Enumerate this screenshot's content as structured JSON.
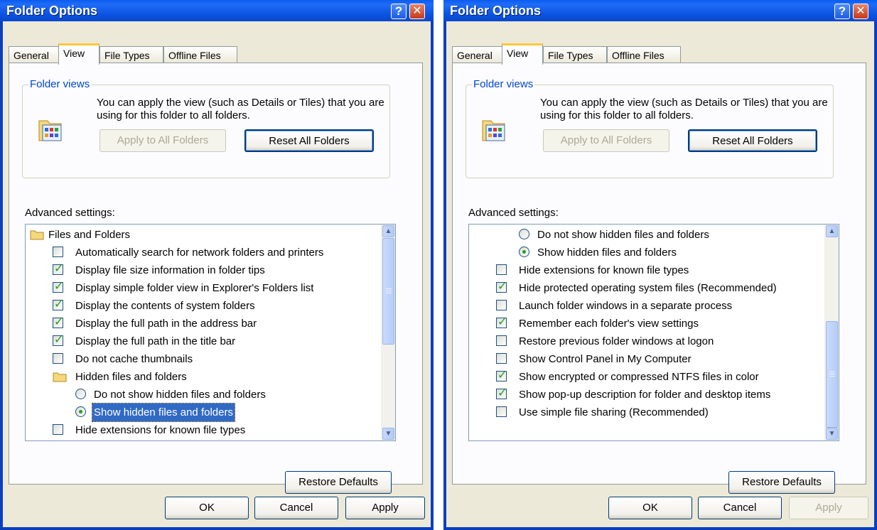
{
  "windows": [
    {
      "title": "Folder Options",
      "help_glyph": "?",
      "close_glyph": "✕",
      "tabs": [
        "General",
        "View",
        "File Types",
        "Offline Files"
      ],
      "active_tab": "View",
      "folder_views": {
        "title": "Folder views",
        "description": "You can apply the view (such as Details or Tiles) that you are using for this folder to all folders.",
        "apply_button": "Apply to All Folders",
        "apply_enabled": false,
        "reset_button": "Reset All Folders"
      },
      "advanced_label": "Advanced settings:",
      "items": [
        {
          "kind": "folder",
          "label": "Files and Folders"
        },
        {
          "kind": "checkbox",
          "checked": false,
          "label": "Automatically search for network folders and printers"
        },
        {
          "kind": "checkbox",
          "checked": true,
          "label": "Display file size information in folder tips"
        },
        {
          "kind": "checkbox",
          "checked": true,
          "label": "Display simple folder view in Explorer's Folders list"
        },
        {
          "kind": "checkbox",
          "checked": true,
          "label": "Display the contents of system folders"
        },
        {
          "kind": "checkbox",
          "checked": true,
          "label": "Display the full path in the address bar"
        },
        {
          "kind": "checkbox",
          "checked": true,
          "label": "Display the full path in the title bar"
        },
        {
          "kind": "checkbox",
          "checked": false,
          "label": "Do not cache thumbnails"
        },
        {
          "kind": "folder",
          "label": "Hidden files and folders"
        },
        {
          "kind": "radio",
          "checked": false,
          "label": "Do not show hidden files and folders"
        },
        {
          "kind": "radio",
          "checked": true,
          "selected": true,
          "label": "Show hidden files and folders"
        },
        {
          "kind": "checkbox",
          "checked": false,
          "label": "Hide extensions for known file types"
        }
      ],
      "scroll_position": "top",
      "restore_button": "Restore Defaults",
      "ok_button": "OK",
      "cancel_button": "Cancel",
      "apply_button": "Apply",
      "apply_enabled": true
    },
    {
      "title": "Folder Options",
      "help_glyph": "?",
      "close_glyph": "✕",
      "tabs": [
        "General",
        "View",
        "File Types",
        "Offline Files"
      ],
      "active_tab": "View",
      "folder_views": {
        "title": "Folder views",
        "description": "You can apply the view (such as Details or Tiles) that you are using for this folder to all folders.",
        "apply_button": "Apply to All Folders",
        "apply_enabled": false,
        "reset_button": "Reset All Folders"
      },
      "advanced_label": "Advanced settings:",
      "items": [
        {
          "kind": "radio",
          "checked": false,
          "label": "Do not show hidden files and folders"
        },
        {
          "kind": "radio",
          "checked": true,
          "label": "Show hidden files and folders"
        },
        {
          "kind": "checkbox",
          "checked": false,
          "label": "Hide extensions for known file types"
        },
        {
          "kind": "checkbox",
          "checked": true,
          "label": "Hide protected operating system files (Recommended)"
        },
        {
          "kind": "checkbox",
          "checked": false,
          "label": "Launch folder windows in a separate process"
        },
        {
          "kind": "checkbox",
          "checked": true,
          "label": "Remember each folder's view settings"
        },
        {
          "kind": "checkbox",
          "checked": false,
          "label": "Restore previous folder windows at logon"
        },
        {
          "kind": "checkbox",
          "checked": false,
          "label": "Show Control Panel in My Computer"
        },
        {
          "kind": "checkbox",
          "checked": true,
          "label": "Show encrypted or compressed NTFS files in color"
        },
        {
          "kind": "checkbox",
          "checked": true,
          "label": "Show pop-up description for folder and desktop items"
        },
        {
          "kind": "checkbox",
          "checked": false,
          "label": "Use simple file sharing (Recommended)"
        }
      ],
      "scroll_position": "bottom",
      "restore_button": "Restore Defaults",
      "ok_button": "OK",
      "cancel_button": "Cancel",
      "apply_button": "Apply",
      "apply_enabled": false
    }
  ],
  "colors": {
    "title_bar": "#0a5bf0",
    "dialog_face": "#ece9d8",
    "group_title": "#0046d5",
    "selection": "#316ac5",
    "check_mark": "#21a121"
  }
}
